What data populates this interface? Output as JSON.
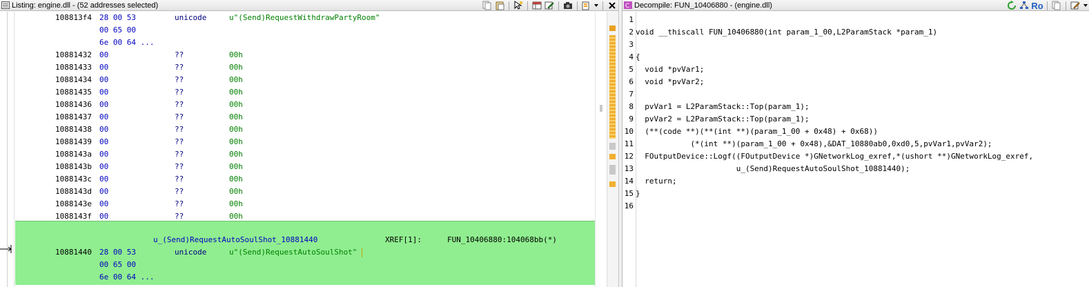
{
  "listing": {
    "title": "Listing:  engine.dll - (52 addresses selected)",
    "top_rows": [
      {
        "addr": "108813f4",
        "bytes": "28 00 53",
        "mnem": "unicode",
        "val": "u\"(Send)RequestWithdrawPartyRoom\""
      },
      {
        "addr": "",
        "bytes": "00 65 00",
        "mnem": "",
        "val": ""
      },
      {
        "addr": "",
        "bytes": "6e 00 64 ...",
        "mnem": "",
        "val": ""
      },
      {
        "addr": "10881432",
        "bytes": "00",
        "mnem": "??",
        "val": "00h"
      },
      {
        "addr": "10881433",
        "bytes": "00",
        "mnem": "??",
        "val": "00h"
      },
      {
        "addr": "10881434",
        "bytes": "00",
        "mnem": "??",
        "val": "00h"
      },
      {
        "addr": "10881435",
        "bytes": "00",
        "mnem": "??",
        "val": "00h"
      },
      {
        "addr": "10881436",
        "bytes": "00",
        "mnem": "??",
        "val": "00h"
      },
      {
        "addr": "10881437",
        "bytes": "00",
        "mnem": "??",
        "val": "00h"
      },
      {
        "addr": "10881438",
        "bytes": "00",
        "mnem": "??",
        "val": "00h"
      },
      {
        "addr": "10881439",
        "bytes": "00",
        "mnem": "??",
        "val": "00h"
      },
      {
        "addr": "1088143a",
        "bytes": "00",
        "mnem": "??",
        "val": "00h"
      },
      {
        "addr": "1088143b",
        "bytes": "00",
        "mnem": "??",
        "val": "00h"
      },
      {
        "addr": "1088143c",
        "bytes": "00",
        "mnem": "??",
        "val": "00h"
      },
      {
        "addr": "1088143d",
        "bytes": "00",
        "mnem": "??",
        "val": "00h"
      },
      {
        "addr": "1088143e",
        "bytes": "00",
        "mnem": "??",
        "val": "00h"
      },
      {
        "addr": "1088143f",
        "bytes": "00",
        "mnem": "??",
        "val": "00h"
      }
    ],
    "selected_label": "u_(Send)RequestAutoSoulShot_10881440",
    "xref_label": "XREF[1]:",
    "xref_value": "FUN_10406880:104068bb(*)",
    "selected_rows": [
      {
        "addr": "10881440",
        "bytes": "28 00 53",
        "mnem": "unicode",
        "val": "u\"(Send)RequestAutoSoulShot\""
      },
      {
        "addr": "",
        "bytes": "00 65 00",
        "mnem": "",
        "val": ""
      },
      {
        "addr": "",
        "bytes": "6e 00 64 ...",
        "mnem": "",
        "val": ""
      }
    ],
    "icons": [
      "copy-icon",
      "paste-icon",
      "cursor-select-icon",
      "table-icon",
      "edit-icon",
      "camera-icon",
      "memory-icon",
      "dropdown-icon",
      "close-icon"
    ]
  },
  "decompile": {
    "title": "Decompile: FUN_10406880 -  (engine.dll)",
    "toolbar_ro": "Ro",
    "icons": [
      "refresh-icon",
      "graph-icon",
      "copy-icon",
      "edit-icon",
      "dropdown-icon"
    ],
    "lines": [
      {
        "n": "1",
        "text": ""
      },
      {
        "n": "2",
        "text": "void __thiscall FUN_10406880(int param_1_00,L2ParamStack *param_1)"
      },
      {
        "n": "3",
        "text": ""
      },
      {
        "n": "4",
        "text": "{"
      },
      {
        "n": "5",
        "text": "  void *pvVar1;"
      },
      {
        "n": "6",
        "text": "  void *pvVar2;"
      },
      {
        "n": "7",
        "text": "  "
      },
      {
        "n": "8",
        "text": "  pvVar1 = L2ParamStack::Top(param_1);"
      },
      {
        "n": "9",
        "text": "  pvVar2 = L2ParamStack::Top(param_1);"
      },
      {
        "n": "10",
        "text": "  (**(code **)(**(int **)(param_1_00 + 0x48) + 0x68))"
      },
      {
        "n": "11",
        "text": "            (*(int **)(param_1_00 + 0x48),&DAT_10880ab0,0xd0,5,pvVar1,pvVar2);"
      },
      {
        "n": "12",
        "text": "  FOutputDevice::Logf((FOutputDevice *)GNetworkLog_exref,*(ushort **)GNetworkLog_exref,"
      },
      {
        "n": "13",
        "text": "                      u_(Send)RequestAutoSoulShot_10881440);"
      },
      {
        "n": "14",
        "text": "  return;"
      },
      {
        "n": "15",
        "text": "}"
      },
      {
        "n": "16",
        "text": ""
      }
    ]
  },
  "colors": {
    "selection": "#90ee90",
    "address": "#000000",
    "bytes": "#0000c0",
    "value": "#008000",
    "mnemonic": "#000080"
  }
}
